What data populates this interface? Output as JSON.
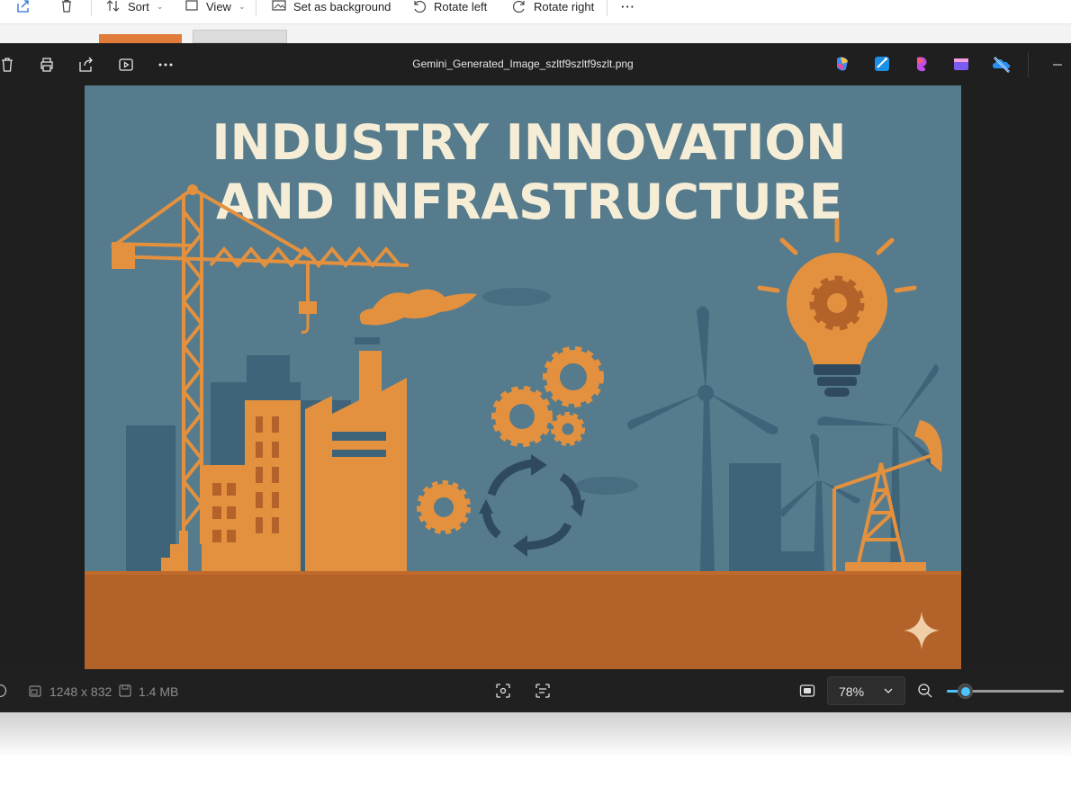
{
  "explorer_toolbar": {
    "sort_label": "Sort",
    "view_label": "View",
    "set_background_label": "Set as background",
    "rotate_left_label": "Rotate left",
    "rotate_right_label": "Rotate right",
    "more_label": "···",
    "icons": [
      "share-icon",
      "trash-icon",
      "sort-icon",
      "view-icon",
      "background-icon",
      "rotate-left-icon",
      "rotate-right-icon",
      "more-icon"
    ]
  },
  "viewer": {
    "filename": "Gemini_Generated_Image_szltf9szltf9szlt.png",
    "toolbar_icons": [
      "trash-icon",
      "print-icon",
      "share-icon",
      "slideshow-icon",
      "more-icon"
    ],
    "app_icons": [
      "copilot-icon",
      "photo-editor-icon",
      "clipchamp-icon",
      "designer-icon",
      "onedrive-icon"
    ],
    "image": {
      "title_line1": "INDUSTRY INNOVATION",
      "title_line2": "AND INFRASTRUCTURE",
      "background_color": "#557b8c",
      "ground_color": "#b3622a",
      "accent_color": "#e3913f",
      "dark_color": "#2f4a5e"
    },
    "status": {
      "dimensions": "1248 x 832",
      "file_size": "1.4 MB",
      "zoom": "78%",
      "zoom_slider_value": 0.15
    }
  }
}
